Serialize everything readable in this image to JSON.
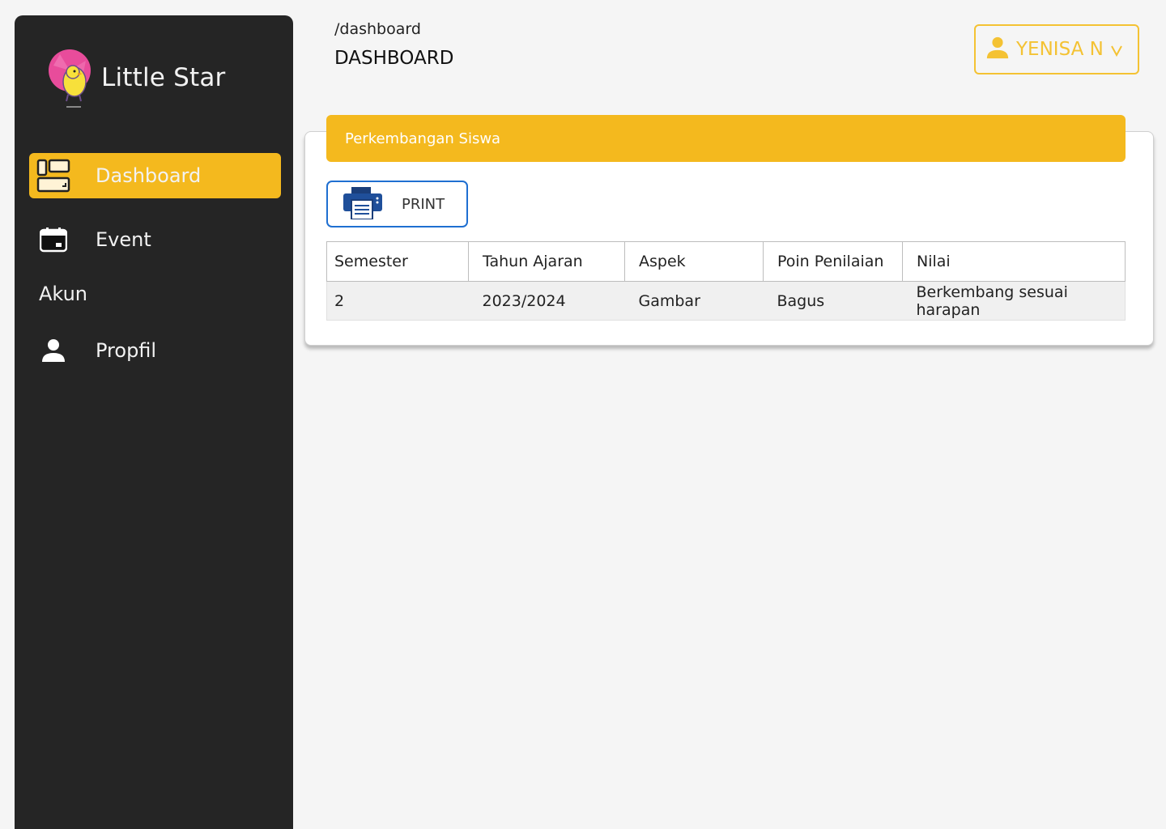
{
  "app": {
    "name": "Little Star"
  },
  "sidebar": {
    "items": [
      {
        "label": "Dashboard",
        "icon": "dashboard-icon",
        "active": true
      },
      {
        "label": "Event",
        "icon": "calendar-icon",
        "active": false
      }
    ],
    "section": "Akun",
    "account_items": [
      {
        "label": "Propfil",
        "icon": "user-icon"
      }
    ]
  },
  "header": {
    "breadcrumb": "/dashboard",
    "title": "DASHBOARD",
    "user_name": "YENISA N",
    "chevron": "v"
  },
  "card": {
    "title": "Perkembangan Siswa",
    "print_label": "PRINT"
  },
  "table": {
    "columns": [
      "Semester",
      "Tahun Ajaran",
      "Aspek",
      "Poin Penilaian",
      "Nilai"
    ],
    "rows": [
      [
        "2",
        "2023/2024",
        "Gambar",
        "Bagus",
        "Berkembang sesuai harapan"
      ]
    ]
  },
  "colors": {
    "accent": "#f4b91e",
    "sidebar": "#252525",
    "print_border": "#1f6fd1",
    "user_accent": "#f4c233"
  }
}
